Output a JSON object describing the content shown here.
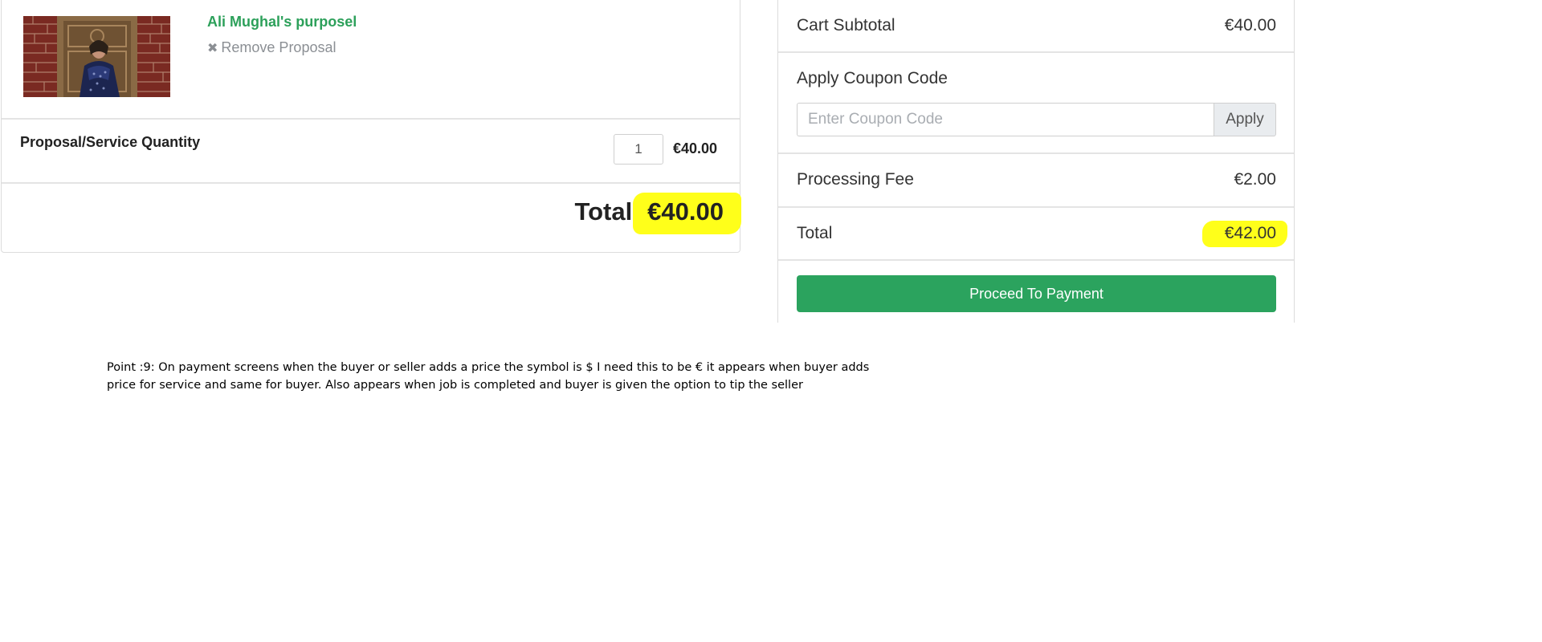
{
  "cart": {
    "proposal_title": "Ali Mughal's purposel",
    "remove_label": "Remove Proposal",
    "remove_icon": "close-x-icon",
    "quantity_label": "Proposal/Service Quantity",
    "quantity_value": "1",
    "line_price": "€40.00",
    "total_label": "Total:",
    "total_value": "€40.00"
  },
  "summary": {
    "subtotal_label": "Cart Subtotal",
    "subtotal_value": "€40.00",
    "coupon_heading": "Apply Coupon Code",
    "coupon_placeholder": "Enter Coupon Code",
    "apply_label": "Apply",
    "fee_label": "Processing Fee",
    "fee_value": "€2.00",
    "total_label": "Total",
    "total_value": "€42.00",
    "pay_label": "Proceed To Payment"
  },
  "note": {
    "line1": "Point :9:     On payment screens when the buyer or seller adds a price the symbol is $ I need this to be € it appears when buyer adds",
    "line2": "price for service and same for buyer.  Also appears when job is completed and buyer is given the option to tip the seller"
  },
  "colors": {
    "accent_green": "#2ba35e",
    "title_green": "#2ca05a",
    "highlight_yellow": "#ffff1a"
  }
}
